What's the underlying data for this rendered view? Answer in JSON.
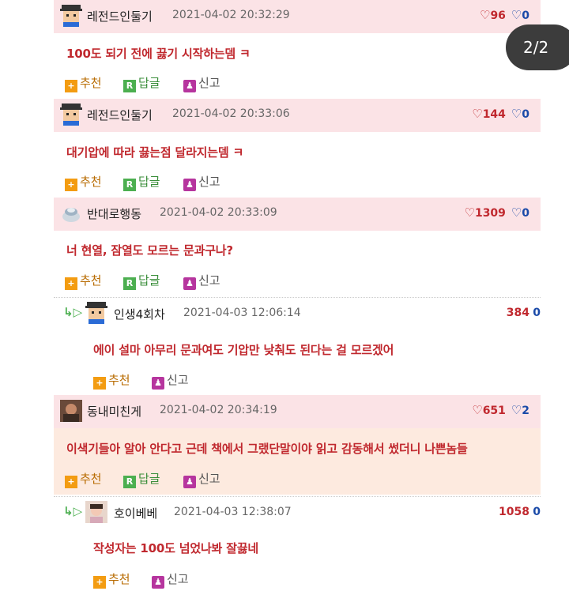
{
  "pager": {
    "label": "2/2"
  },
  "comments": [
    {
      "nick": "레전드인둘기",
      "date": "2021-04-02 20:32:29",
      "up": "96",
      "down": "0",
      "text": "100도 되기 전에 끓기 시작하는뎀 ㅋ",
      "actions": [
        "추천",
        "답글",
        "신고"
      ]
    },
    {
      "nick": "레전드인둘기",
      "date": "2021-04-02 20:33:06",
      "up": "144",
      "down": "0",
      "text": "대기압에 따라 끓는점 달라지는뎀 ㅋ",
      "actions": [
        "추천",
        "답글",
        "신고"
      ]
    },
    {
      "nick": "반대로행동",
      "date": "2021-04-02 20:33:09",
      "up": "1309",
      "down": "0",
      "text": "너 현열, 잠열도 모르는 문과구나?",
      "actions": [
        "추천",
        "답글",
        "신고"
      ]
    },
    {
      "nick": "인생4회차",
      "date": "2021-04-03 12:06:14",
      "up": "384",
      "down": "0",
      "text": "에이 설마 아무리 문과여도 기압만 낮춰도 된다는 걸 모르겠어",
      "actions": [
        "추천",
        "신고"
      ]
    },
    {
      "nick": "동내미친게",
      "date": "2021-04-02 20:34:19",
      "up": "651",
      "down": "2",
      "text": "이색기들아 알아 안다고 근데 책에서 그랬단말이야 읽고 감동해서 썼더니 나쁜놈들",
      "actions": [
        "추천",
        "답글",
        "신고"
      ]
    },
    {
      "nick": "호이베베",
      "date": "2021-04-03 12:38:07",
      "up": "1058",
      "down": "0",
      "text": "작성자는 100도 넘었나봐 잘끓네",
      "actions": [
        "추천",
        "신고"
      ]
    }
  ],
  "badges": {
    "recommend": "+",
    "reply": "R",
    "report": "♟"
  },
  "icons": {
    "thumbs_up": "👍",
    "thumbs_down": "👎",
    "reply_arrow": "↳"
  },
  "colors": {
    "header_bg": "#fbe3e6",
    "highlight_bg": "#fdeadf",
    "text_red": "#c0282e",
    "down_blue": "#1a4aa8"
  }
}
